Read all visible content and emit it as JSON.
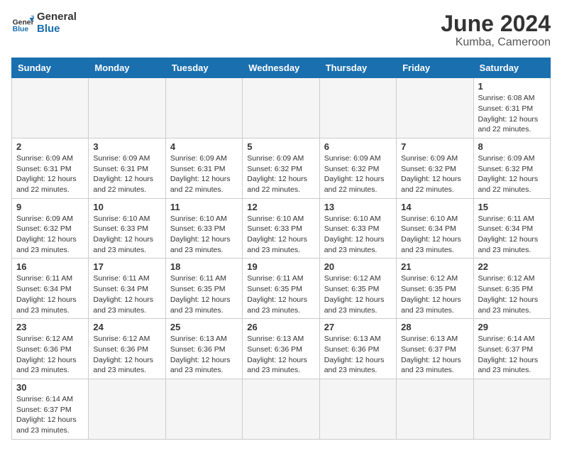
{
  "header": {
    "logo_general": "General",
    "logo_blue": "Blue",
    "title": "June 2024",
    "subtitle": "Kumba, Cameroon"
  },
  "weekdays": [
    "Sunday",
    "Monday",
    "Tuesday",
    "Wednesday",
    "Thursday",
    "Friday",
    "Saturday"
  ],
  "weeks": [
    [
      {
        "day": "",
        "info": ""
      },
      {
        "day": "",
        "info": ""
      },
      {
        "day": "",
        "info": ""
      },
      {
        "day": "",
        "info": ""
      },
      {
        "day": "",
        "info": ""
      },
      {
        "day": "",
        "info": ""
      },
      {
        "day": "1",
        "info": "Sunrise: 6:08 AM\nSunset: 6:31 PM\nDaylight: 12 hours and 22 minutes."
      }
    ],
    [
      {
        "day": "2",
        "info": "Sunrise: 6:09 AM\nSunset: 6:31 PM\nDaylight: 12 hours and 22 minutes."
      },
      {
        "day": "3",
        "info": "Sunrise: 6:09 AM\nSunset: 6:31 PM\nDaylight: 12 hours and 22 minutes."
      },
      {
        "day": "4",
        "info": "Sunrise: 6:09 AM\nSunset: 6:31 PM\nDaylight: 12 hours and 22 minutes."
      },
      {
        "day": "5",
        "info": "Sunrise: 6:09 AM\nSunset: 6:32 PM\nDaylight: 12 hours and 22 minutes."
      },
      {
        "day": "6",
        "info": "Sunrise: 6:09 AM\nSunset: 6:32 PM\nDaylight: 12 hours and 22 minutes."
      },
      {
        "day": "7",
        "info": "Sunrise: 6:09 AM\nSunset: 6:32 PM\nDaylight: 12 hours and 22 minutes."
      },
      {
        "day": "8",
        "info": "Sunrise: 6:09 AM\nSunset: 6:32 PM\nDaylight: 12 hours and 22 minutes."
      }
    ],
    [
      {
        "day": "9",
        "info": "Sunrise: 6:09 AM\nSunset: 6:32 PM\nDaylight: 12 hours and 23 minutes."
      },
      {
        "day": "10",
        "info": "Sunrise: 6:10 AM\nSunset: 6:33 PM\nDaylight: 12 hours and 23 minutes."
      },
      {
        "day": "11",
        "info": "Sunrise: 6:10 AM\nSunset: 6:33 PM\nDaylight: 12 hours and 23 minutes."
      },
      {
        "day": "12",
        "info": "Sunrise: 6:10 AM\nSunset: 6:33 PM\nDaylight: 12 hours and 23 minutes."
      },
      {
        "day": "13",
        "info": "Sunrise: 6:10 AM\nSunset: 6:33 PM\nDaylight: 12 hours and 23 minutes."
      },
      {
        "day": "14",
        "info": "Sunrise: 6:10 AM\nSunset: 6:34 PM\nDaylight: 12 hours and 23 minutes."
      },
      {
        "day": "15",
        "info": "Sunrise: 6:11 AM\nSunset: 6:34 PM\nDaylight: 12 hours and 23 minutes."
      }
    ],
    [
      {
        "day": "16",
        "info": "Sunrise: 6:11 AM\nSunset: 6:34 PM\nDaylight: 12 hours and 23 minutes."
      },
      {
        "day": "17",
        "info": "Sunrise: 6:11 AM\nSunset: 6:34 PM\nDaylight: 12 hours and 23 minutes."
      },
      {
        "day": "18",
        "info": "Sunrise: 6:11 AM\nSunset: 6:35 PM\nDaylight: 12 hours and 23 minutes."
      },
      {
        "day": "19",
        "info": "Sunrise: 6:11 AM\nSunset: 6:35 PM\nDaylight: 12 hours and 23 minutes."
      },
      {
        "day": "20",
        "info": "Sunrise: 6:12 AM\nSunset: 6:35 PM\nDaylight: 12 hours and 23 minutes."
      },
      {
        "day": "21",
        "info": "Sunrise: 6:12 AM\nSunset: 6:35 PM\nDaylight: 12 hours and 23 minutes."
      },
      {
        "day": "22",
        "info": "Sunrise: 6:12 AM\nSunset: 6:35 PM\nDaylight: 12 hours and 23 minutes."
      }
    ],
    [
      {
        "day": "23",
        "info": "Sunrise: 6:12 AM\nSunset: 6:36 PM\nDaylight: 12 hours and 23 minutes."
      },
      {
        "day": "24",
        "info": "Sunrise: 6:12 AM\nSunset: 6:36 PM\nDaylight: 12 hours and 23 minutes."
      },
      {
        "day": "25",
        "info": "Sunrise: 6:13 AM\nSunset: 6:36 PM\nDaylight: 12 hours and 23 minutes."
      },
      {
        "day": "26",
        "info": "Sunrise: 6:13 AM\nSunset: 6:36 PM\nDaylight: 12 hours and 23 minutes."
      },
      {
        "day": "27",
        "info": "Sunrise: 6:13 AM\nSunset: 6:36 PM\nDaylight: 12 hours and 23 minutes."
      },
      {
        "day": "28",
        "info": "Sunrise: 6:13 AM\nSunset: 6:37 PM\nDaylight: 12 hours and 23 minutes."
      },
      {
        "day": "29",
        "info": "Sunrise: 6:14 AM\nSunset: 6:37 PM\nDaylight: 12 hours and 23 minutes."
      }
    ],
    [
      {
        "day": "30",
        "info": "Sunrise: 6:14 AM\nSunset: 6:37 PM\nDaylight: 12 hours and 23 minutes."
      },
      {
        "day": "",
        "info": ""
      },
      {
        "day": "",
        "info": ""
      },
      {
        "day": "",
        "info": ""
      },
      {
        "day": "",
        "info": ""
      },
      {
        "day": "",
        "info": ""
      },
      {
        "day": "",
        "info": ""
      }
    ]
  ]
}
